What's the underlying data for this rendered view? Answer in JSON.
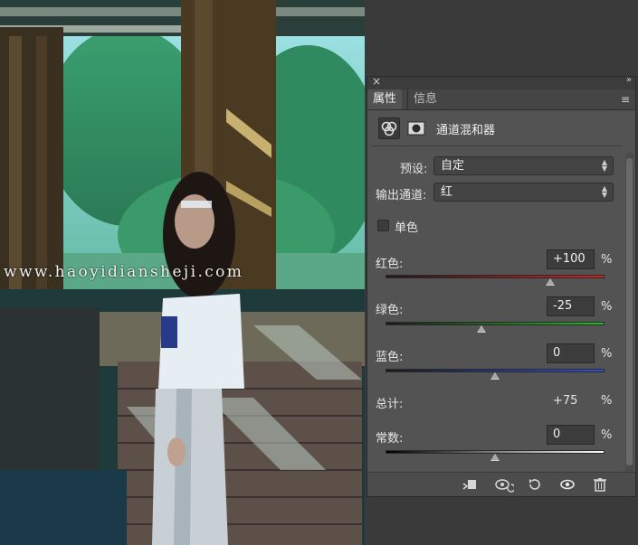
{
  "watermark": "www.haoyidiansheji.com",
  "panel": {
    "close_glyph": "×",
    "collapse_glyph": "»",
    "tabs": [
      {
        "label": "属性",
        "active": true
      },
      {
        "label": "信息",
        "active": false
      }
    ],
    "menu_glyph": "≡",
    "header": {
      "icons": [
        "channel-mixer-icon",
        "mask-icon"
      ],
      "title": "通道混和器"
    },
    "preset": {
      "label": "预设:",
      "value": "自定"
    },
    "output_channel": {
      "label": "输出通道:",
      "value": "红"
    },
    "monochrome": {
      "label": "单色",
      "checked": false
    },
    "channels": [
      {
        "label": "红色:",
        "value": "+100",
        "unit": "%",
        "level": 100,
        "gradient": [
          "#1a1a1a",
          "#e02020"
        ]
      },
      {
        "label": "绿色:",
        "value": "-25",
        "unit": "%",
        "level": -25,
        "gradient": [
          "#1a1a1a",
          "#20c020"
        ]
      },
      {
        "label": "蓝色:",
        "value": "0",
        "unit": "%",
        "level": 0,
        "gradient": [
          "#1a1a1a",
          "#3050e0"
        ]
      }
    ],
    "total": {
      "label": "总计:",
      "value": "+75",
      "unit": "%"
    },
    "constant": {
      "label": "常数:",
      "value": "0",
      "unit": "%",
      "level": 0,
      "gradient": [
        "#000000",
        "#ffffff"
      ]
    },
    "slider_range": [
      -200,
      200
    ],
    "bottom_icons": [
      "clip-to-layer-icon",
      "view-previous-state-icon",
      "reset-icon",
      "toggle-visibility-icon",
      "delete-icon"
    ]
  }
}
